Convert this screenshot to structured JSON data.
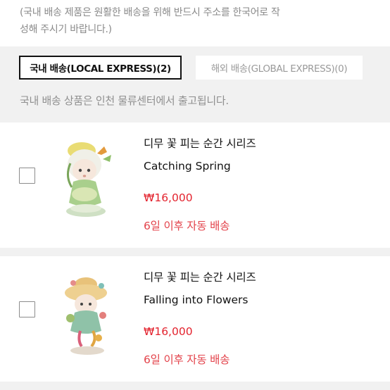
{
  "notice": {
    "line1": "(국내 배송 제품은 원활한 배송을 위해 반드시 주소를 한국어로 작",
    "line2": "성해 주시기 바랍니다.)"
  },
  "tabs": {
    "local": "국내 배송(LOCAL EXPRESS)(2)",
    "global": "해외 배송(GLOBAL EXPRESS)(0)"
  },
  "sub_notice": "국내 배송 상품은 인천 물류센터에서 출고됩니다.",
  "items": [
    {
      "series": "디무 꽃 피는 순간 시리즈",
      "name": "Catching Spring",
      "price": "₩16,000",
      "shipping": "6일 이후 자동 배송"
    },
    {
      "series": "디무 꽃 피는 순간 시리즈",
      "name": "Falling into Flowers",
      "price": "₩16,000",
      "shipping": "6일 이후 자동 배송"
    }
  ],
  "colors": {
    "price": "#e3232e",
    "shipping": "#e3434b",
    "background": "#f1f1f1"
  }
}
